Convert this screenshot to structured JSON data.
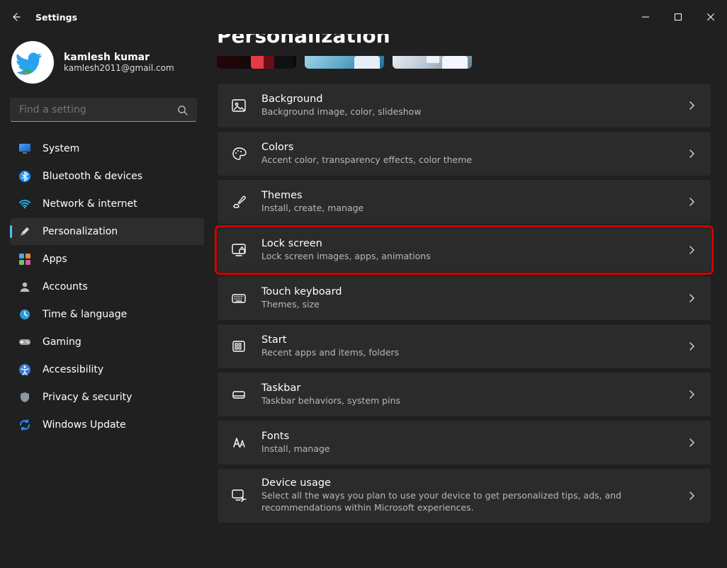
{
  "app": {
    "title": "Settings"
  },
  "profile": {
    "name": "kamlesh kumar",
    "email": "kamlesh2011@gmail.com"
  },
  "search": {
    "placeholder": "Find a setting"
  },
  "sidebar": {
    "items": [
      {
        "id": "system",
        "label": "System"
      },
      {
        "id": "bluetooth",
        "label": "Bluetooth & devices"
      },
      {
        "id": "network",
        "label": "Network & internet"
      },
      {
        "id": "personalization",
        "label": "Personalization",
        "selected": true
      },
      {
        "id": "apps",
        "label": "Apps"
      },
      {
        "id": "accounts",
        "label": "Accounts"
      },
      {
        "id": "time",
        "label": "Time & language"
      },
      {
        "id": "gaming",
        "label": "Gaming"
      },
      {
        "id": "accessibility",
        "label": "Accessibility"
      },
      {
        "id": "privacy",
        "label": "Privacy & security"
      },
      {
        "id": "update",
        "label": "Windows Update"
      }
    ]
  },
  "page": {
    "title": "Personalization",
    "cards": [
      {
        "id": "background",
        "title": "Background",
        "sub": "Background image, color, slideshow"
      },
      {
        "id": "colors",
        "title": "Colors",
        "sub": "Accent color, transparency effects, color theme"
      },
      {
        "id": "themes",
        "title": "Themes",
        "sub": "Install, create, manage"
      },
      {
        "id": "lockscreen",
        "title": "Lock screen",
        "sub": "Lock screen images, apps, animations",
        "highlight": true
      },
      {
        "id": "touchkb",
        "title": "Touch keyboard",
        "sub": "Themes, size"
      },
      {
        "id": "start",
        "title": "Start",
        "sub": "Recent apps and items, folders"
      },
      {
        "id": "taskbar",
        "title": "Taskbar",
        "sub": "Taskbar behaviors, system pins"
      },
      {
        "id": "fonts",
        "title": "Fonts",
        "sub": "Install, manage"
      },
      {
        "id": "deviceusage",
        "title": "Device usage",
        "sub": "Select all the ways you plan to use your device to get personalized tips, ads, and recommendations within Microsoft experiences."
      }
    ]
  }
}
